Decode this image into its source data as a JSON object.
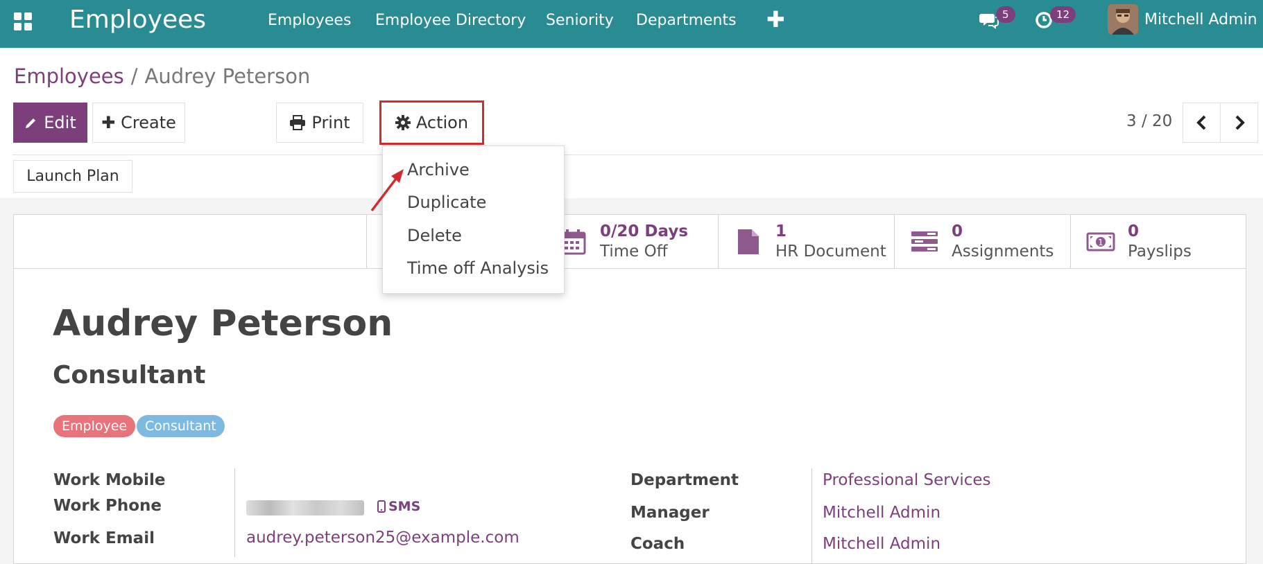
{
  "topbar": {
    "app_title": "Employees",
    "nav": [
      {
        "label": "Employees"
      },
      {
        "label": "Employee Directory"
      },
      {
        "label": "Seniority"
      },
      {
        "label": "Departments"
      }
    ],
    "messages_count": "5",
    "activities_count": "12",
    "user_name": "Mitchell Admin"
  },
  "breadcrumb": {
    "parent": "Employees",
    "separator": "/",
    "current": "Audrey Peterson"
  },
  "toolbar": {
    "edit_label": "Edit",
    "create_label": "Create",
    "print_label": "Print",
    "action_label": "Action",
    "pager": "3 / 20"
  },
  "action_menu": {
    "items": [
      "Archive",
      "Duplicate",
      "Delete",
      "Time off Analysis"
    ]
  },
  "statusbar": {
    "launch_plan_label": "Launch Plan"
  },
  "smart_buttons": [
    {
      "value": "0/20 Days",
      "label": "Time Off",
      "icon": "calendar-icon"
    },
    {
      "value": "1",
      "label": "HR Document",
      "icon": "file-icon"
    },
    {
      "value": "0",
      "label": "Assignments",
      "icon": "tasks-icon"
    },
    {
      "value": "0",
      "label": "Payslips",
      "icon": "money-icon"
    }
  ],
  "employee": {
    "name": "Audrey Peterson",
    "job_title": "Consultant",
    "tags": [
      {
        "label": "Employee",
        "color": "#e9737a"
      },
      {
        "label": "Consultant",
        "color": "#7cb9e3"
      }
    ]
  },
  "fields_left": {
    "work_mobile_label": "Work Mobile",
    "work_phone_label": "Work Phone",
    "sms_label": "SMS",
    "work_email_label": "Work Email",
    "work_email_value": "audrey.peterson25@example.com"
  },
  "fields_right": {
    "department_label": "Department",
    "department_value": "Professional Services",
    "manager_label": "Manager",
    "manager_value": "Mitchell Admin",
    "coach_label": "Coach",
    "coach_value": "Mitchell Admin"
  },
  "colors": {
    "topbar": "#2a8c93",
    "primary": "#7c3f7c",
    "highlight": "#d32b2b"
  }
}
